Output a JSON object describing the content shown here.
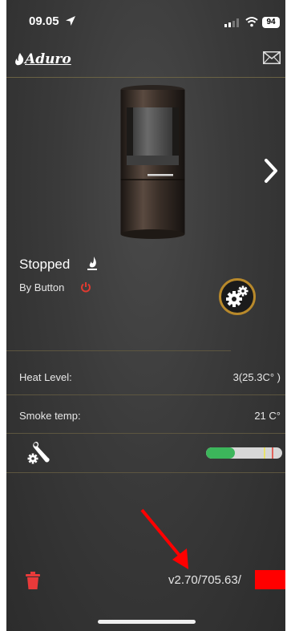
{
  "status_bar": {
    "time": "09.05",
    "battery": "94"
  },
  "header": {
    "brand": "Aduro"
  },
  "stove_status": {
    "state": "Stopped",
    "source": "By Button"
  },
  "rows": [
    {
      "label": "Heat Level:",
      "value": "3(25.3C° )"
    },
    {
      "label": "Smoke temp:",
      "value": "21 C°"
    }
  ],
  "gauge": {
    "fill_fraction": 0.38
  },
  "footer": {
    "version": "v2.70/705.63/"
  },
  "colors": {
    "accent_gold": "#b8892b",
    "power_red": "#e03a30",
    "trash_red": "#e83a3a",
    "gauge_green": "#3cb65b",
    "annotation_red": "#ff0000"
  }
}
